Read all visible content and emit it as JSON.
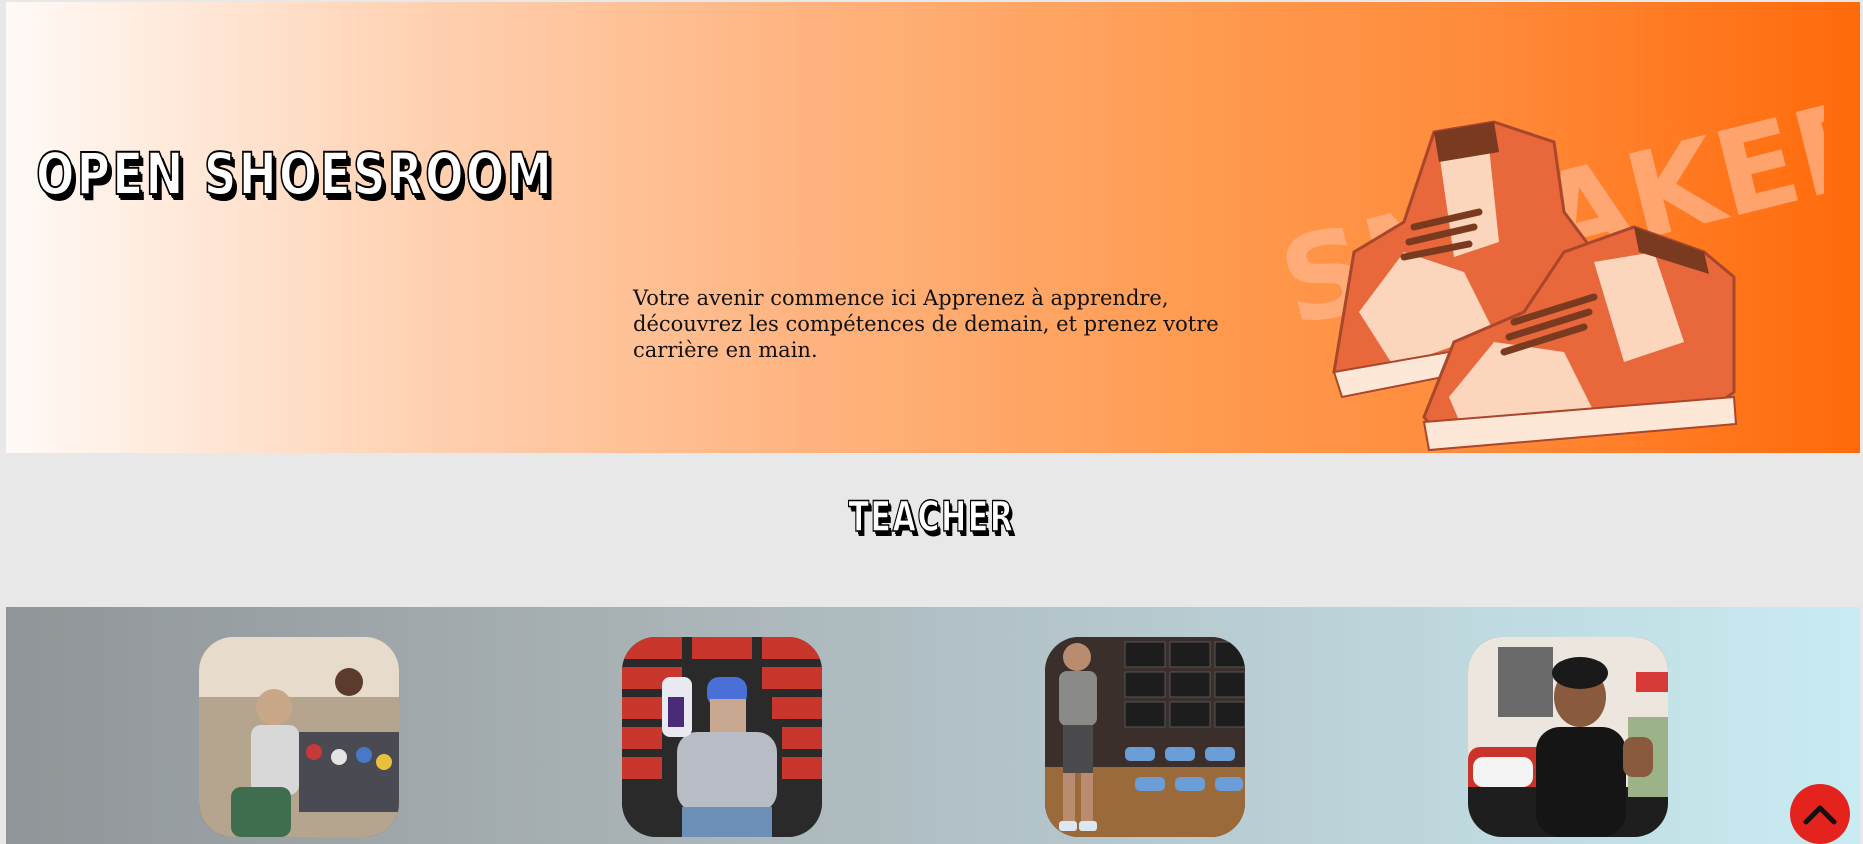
{
  "hero": {
    "brand": "OPEN SHOESROOM",
    "tagline": "Votre avenir commence ici Apprenez à apprendre, découvrez les compétences de demain, et prenez votre carrière en main.",
    "illustration": {
      "icon": "sneakers-illustration",
      "text": "SNEAKERS",
      "colors": {
        "shoe_main": "#e8673b",
        "shoe_light": "#fbd6bc",
        "laces": "#7a3a1f"
      }
    }
  },
  "teachers": {
    "title": "TEACHER",
    "items": [
      {
        "icon": "teacher-photo-1"
      },
      {
        "icon": "teacher-photo-2"
      },
      {
        "icon": "teacher-photo-3"
      },
      {
        "icon": "teacher-photo-4"
      }
    ]
  },
  "scroll_top": {
    "icon": "chevron-up-icon",
    "color": "#e5231e"
  }
}
